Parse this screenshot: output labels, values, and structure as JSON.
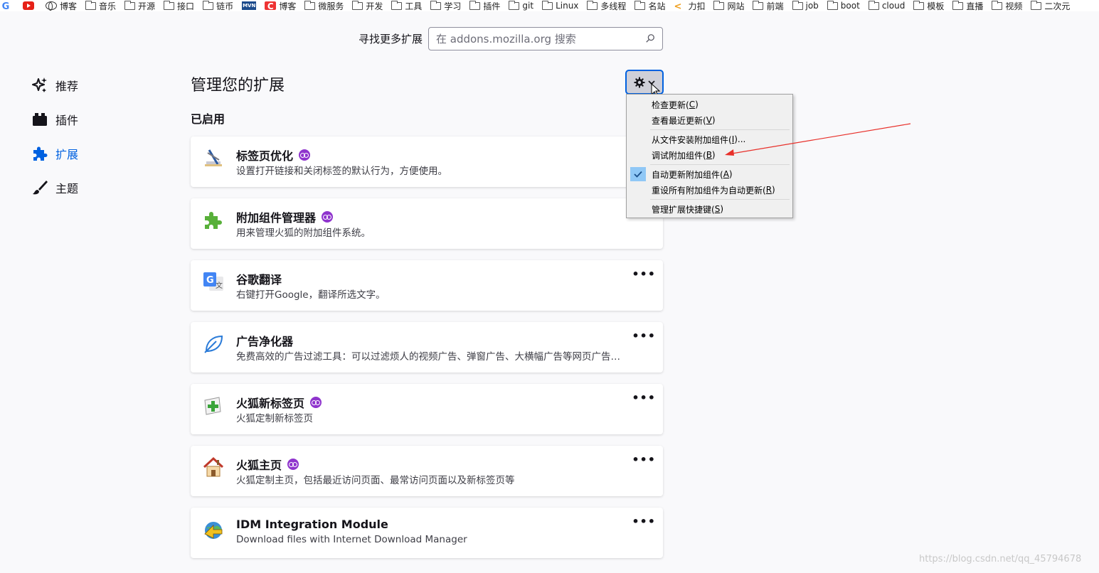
{
  "bookmarks": [
    {
      "label": "",
      "icon": "google-icon"
    },
    {
      "label": "",
      "icon": "youtube-icon"
    },
    {
      "label": "博客",
      "icon": "globe-icon"
    },
    {
      "label": "音乐",
      "icon": "folder-icon"
    },
    {
      "label": "开源",
      "icon": "folder-icon"
    },
    {
      "label": "接口",
      "icon": "folder-icon"
    },
    {
      "label": "链币",
      "icon": "folder-icon"
    },
    {
      "label": "",
      "icon": "mvn-icon",
      "icon_text": "MVN"
    },
    {
      "label": "博客",
      "icon": "csdn-icon",
      "icon_text": "C"
    },
    {
      "label": "微服务",
      "icon": "folder-icon"
    },
    {
      "label": "开发",
      "icon": "folder-icon"
    },
    {
      "label": "工具",
      "icon": "folder-icon"
    },
    {
      "label": "学习",
      "icon": "folder-icon"
    },
    {
      "label": "插件",
      "icon": "folder-icon"
    },
    {
      "label": "git",
      "icon": "folder-icon"
    },
    {
      "label": "Linux",
      "icon": "folder-icon"
    },
    {
      "label": "多线程",
      "icon": "folder-icon"
    },
    {
      "label": "名站",
      "icon": "folder-icon"
    },
    {
      "label": "力扣",
      "icon": "leetcode-icon"
    },
    {
      "label": "网站",
      "icon": "folder-icon"
    },
    {
      "label": "前端",
      "icon": "folder-icon"
    },
    {
      "label": "job",
      "icon": "folder-icon"
    },
    {
      "label": "boot",
      "icon": "folder-icon"
    },
    {
      "label": "cloud",
      "icon": "folder-icon"
    },
    {
      "label": "模板",
      "icon": "folder-icon"
    },
    {
      "label": "直播",
      "icon": "folder-icon"
    },
    {
      "label": "视频",
      "icon": "folder-icon"
    },
    {
      "label": "二次元",
      "icon": "folder-icon"
    }
  ],
  "search": {
    "label": "寻找更多扩展",
    "placeholder": "在 addons.mozilla.org 搜索"
  },
  "sidebar": {
    "items": [
      {
        "label": "推荐",
        "icon": "sparkle-icon",
        "active": false
      },
      {
        "label": "插件",
        "icon": "plugin-icon",
        "active": false
      },
      {
        "label": "扩展",
        "icon": "puzzle-icon",
        "active": true
      },
      {
        "label": "主题",
        "icon": "brush-icon",
        "active": false
      }
    ],
    "active_color": "#0061e0"
  },
  "main": {
    "title": "管理您的扩展",
    "section": "已启用"
  },
  "extensions": [
    {
      "name": "标签页优化",
      "desc": "设置打开链接和关闭标签的默认行为，方便使用。",
      "recommended": true,
      "more": false
    },
    {
      "name": "附加组件管理器",
      "desc": "用来管理火狐的附加组件系统。",
      "recommended": true,
      "more": false
    },
    {
      "name": "谷歌翻译",
      "desc": "右键打开Google，翻译所选文字。",
      "recommended": false,
      "more": true
    },
    {
      "name": "广告净化器",
      "desc": "免费高效的广告过滤工具：可以过滤烦人的视频广告、弹窗广告、大横幅广告等网页广告…",
      "recommended": false,
      "more": true
    },
    {
      "name": "火狐新标签页",
      "desc": "火狐定制新标签页",
      "recommended": true,
      "more": true
    },
    {
      "name": "火狐主页",
      "desc": "火狐定制主页，包括最近访问页面、最常访问页面以及新标签页等",
      "recommended": true,
      "more": true
    },
    {
      "name": "IDM Integration Module",
      "desc": "Download files with Internet Download Manager",
      "recommended": false,
      "more": true
    }
  ],
  "more_glyph": "•••",
  "menu": {
    "items": [
      {
        "label": "检查更新(",
        "key": "C",
        "tail": ")"
      },
      {
        "label": "查看最近更新(",
        "key": "V",
        "tail": ")"
      },
      {
        "label": "从文件安装附加组件(",
        "key": "I",
        "tail": ")..."
      },
      {
        "label": "调试附加组件(",
        "key": "B",
        "tail": ")"
      },
      {
        "label": "自动更新附加组件(",
        "key": "A",
        "tail": ")",
        "checked": true
      },
      {
        "label": "重设所有附加组件为自动更新(",
        "key": "R",
        "tail": ")"
      },
      {
        "label": "管理扩展快捷键(",
        "key": "S",
        "tail": ")"
      }
    ]
  },
  "annotation_color": "#e8302a",
  "watermark": "https://blog.csdn.net/qq_45794678"
}
